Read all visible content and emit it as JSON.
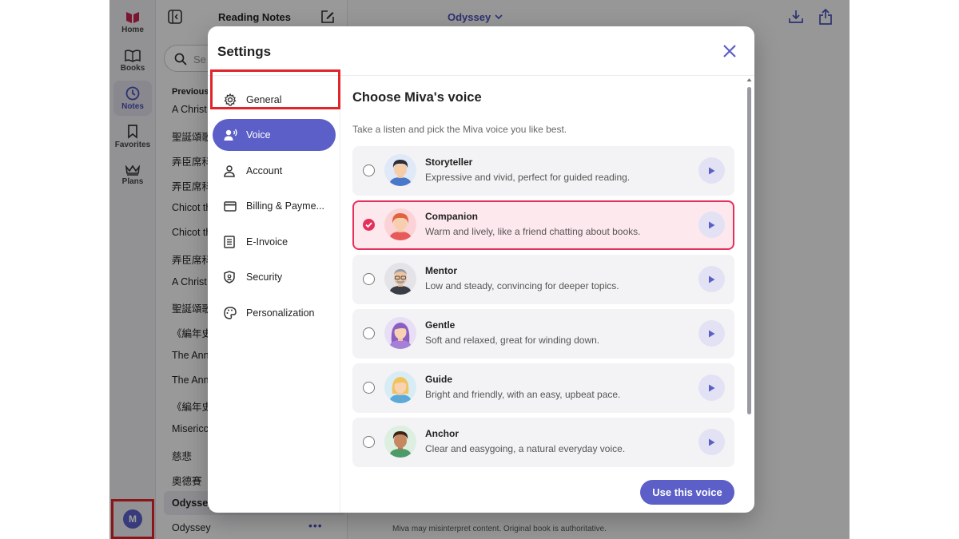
{
  "rail": {
    "items": [
      {
        "label": "Home",
        "icon": "home-logo-icon"
      },
      {
        "label": "Books",
        "icon": "book-icon"
      },
      {
        "label": "Notes",
        "icon": "clock-icon"
      },
      {
        "label": "Favorites",
        "icon": "bookmark-icon"
      },
      {
        "label": "Plans",
        "icon": "crown-icon"
      }
    ],
    "avatar_initial": "M"
  },
  "notes_panel": {
    "title": "Reading Notes",
    "search_placeholder": "Se",
    "section_label": "Previous",
    "items": [
      "A Christ",
      "聖誕頌歌",
      "弄臣席科",
      "弄臣席科",
      "Chicot th",
      "Chicot th",
      "弄臣席科",
      "A Christ",
      "聖誕頌歌",
      "《編年史",
      "The Ann",
      "The Ann",
      "《編年史",
      "Misericc",
      "慈悲",
      "奧德賽",
      "Odyssey",
      "Odyssey"
    ]
  },
  "main": {
    "title": "Odyssey",
    "disclaimer": "Miva may misinterpret content. Original book is authoritative."
  },
  "settings": {
    "title": "Settings",
    "nav": [
      {
        "label": "General",
        "icon": "gear-icon"
      },
      {
        "label": "Voice",
        "icon": "voice-icon"
      },
      {
        "label": "Account",
        "icon": "user-icon"
      },
      {
        "label": "Billing & Payme...",
        "icon": "credit-card-icon"
      },
      {
        "label": "E-Invoice",
        "icon": "invoice-icon"
      },
      {
        "label": "Security",
        "icon": "shield-icon"
      },
      {
        "label": "Personalization",
        "icon": "palette-icon"
      }
    ],
    "active_nav": "Voice",
    "voice": {
      "heading": "Choose Miva's voice",
      "subtitle": "Take a listen and pick the Miva voice you like best.",
      "options": [
        {
          "name": "Storyteller",
          "desc": "Expressive and vivid, perfect for guided reading.",
          "selected": false
        },
        {
          "name": "Companion",
          "desc": "Warm and lively, like a friend chatting about books.",
          "selected": true
        },
        {
          "name": "Mentor",
          "desc": "Low and steady, convincing for deeper topics.",
          "selected": false
        },
        {
          "name": "Gentle",
          "desc": "Soft and relaxed, great for winding down.",
          "selected": false
        },
        {
          "name": "Guide",
          "desc": "Bright and friendly, with an easy, upbeat pace.",
          "selected": false
        },
        {
          "name": "Anchor",
          "desc": "Clear and easygoing, a natural everyday voice.",
          "selected": false
        }
      ],
      "button_label": "Use this voice"
    }
  },
  "colors": {
    "accent": "#5b5fc7",
    "selected": "#e5305b",
    "highlight_box": "#e0252b"
  }
}
